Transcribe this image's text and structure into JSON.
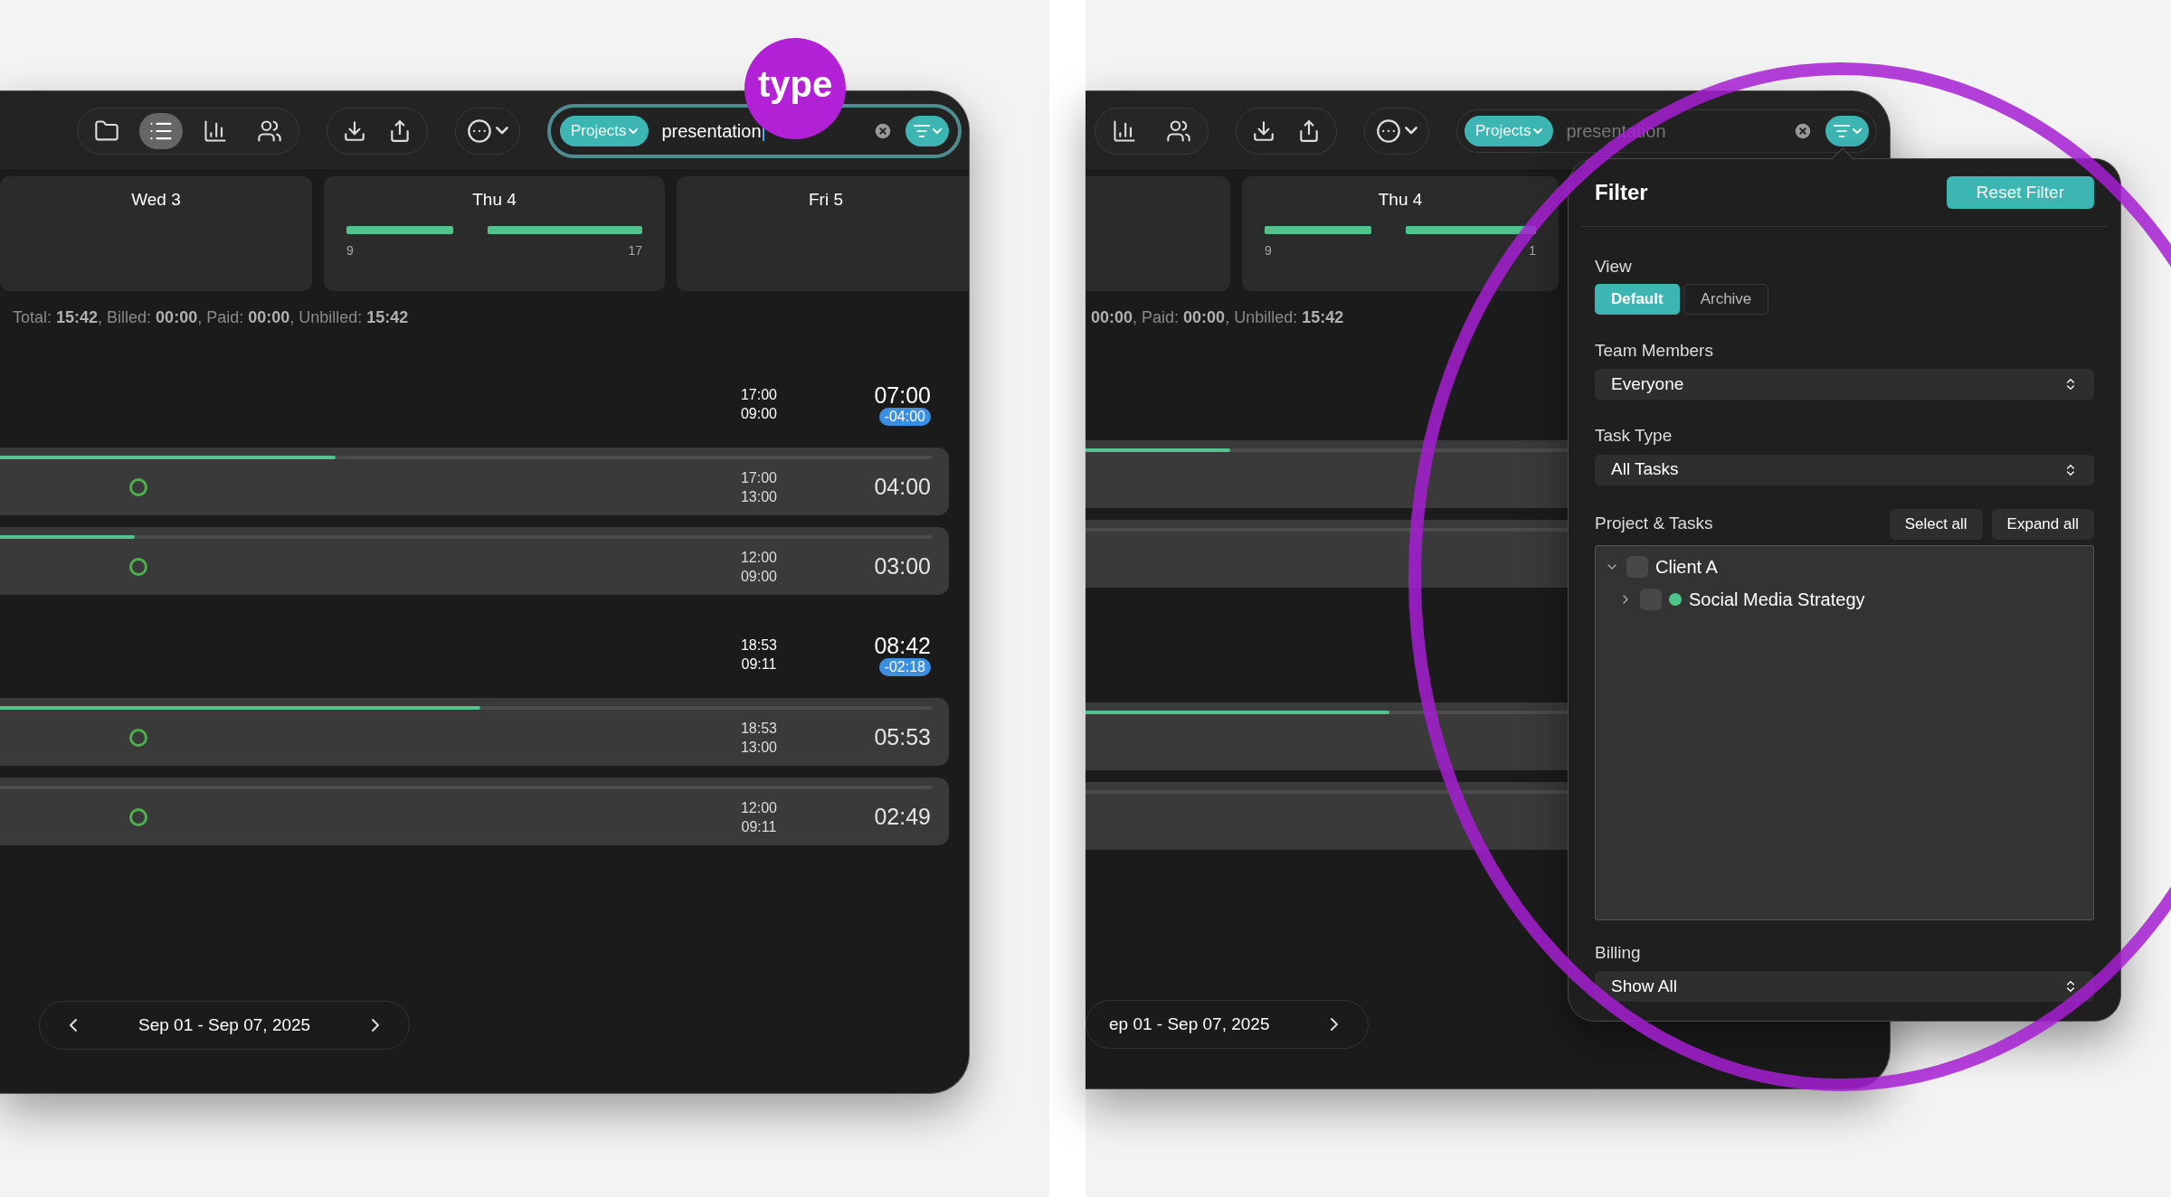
{
  "left_window": {
    "toolbar": {
      "view_buttons": [
        {
          "kind": "folder",
          "selected": false
        },
        {
          "kind": "list",
          "selected": true
        },
        {
          "kind": "chart",
          "selected": false
        },
        {
          "kind": "people",
          "selected": false
        }
      ],
      "search": {
        "scope": "Projects",
        "value": "presentation",
        "focused": true
      }
    },
    "days": [
      {
        "label": "Wed 3"
      },
      {
        "label": "Thu 4",
        "ticks": [
          "9",
          "17"
        ]
      },
      {
        "label": "Fri 5"
      }
    ],
    "summary": "Total: **15:42**, Billed: **00:00**, Paid: **00:00**, Unbilled: **15:42**",
    "groups": [
      {
        "end": "17:00",
        "start": "09:00",
        "total": "07:00",
        "difference": "-04:00",
        "entries": [
          {
            "level": 0.36,
            "end": "17:00",
            "start": "13:00",
            "duration": "04:00"
          },
          {
            "level": 0.145,
            "end": "12:00",
            "start": "09:00",
            "duration": "03:00"
          }
        ]
      },
      {
        "end": "18:53",
        "start": "09:11",
        "total": "08:42",
        "difference": "-02:18",
        "entries": [
          {
            "level": 0.515,
            "end": "18:53",
            "start": "13:00",
            "duration": "05:53"
          },
          {
            "end": "12:00",
            "start": "09:11",
            "duration": "02:49"
          }
        ]
      }
    ],
    "date_range": "Sep 01 - Sep 07, 2025"
  },
  "annotation": {
    "label": "type"
  },
  "right_window": {
    "toolbar": {
      "view_buttons": [
        {
          "kind": "chart",
          "selected": false
        },
        {
          "kind": "people",
          "selected": false
        }
      ],
      "search": {
        "scope": "Projects",
        "value": "presentation",
        "focused": false
      }
    },
    "days": [
      {
        "label": "Thu 4",
        "ticks": [
          "9",
          "1"
        ]
      }
    ],
    "summary": "**00:00**, Paid: **00:00**, Unbilled: **15:42**",
    "entries": [
      {
        "kind": "entry",
        "level": 0.3
      },
      {
        "kind": "entry"
      },
      {
        "kind": "entry",
        "level": 0.63
      },
      {
        "kind": "entry"
      }
    ],
    "date_range": "ep 01 - Sep 07, 2025",
    "filter": {
      "title": "Filter",
      "reset_button": "Reset Filter",
      "view": {
        "label": "View",
        "options": [
          {
            "label": "Default",
            "selected": true
          },
          {
            "label": "Archive",
            "selected": false
          }
        ]
      },
      "team_members": {
        "label": "Team Members",
        "value": "Everyone"
      },
      "task_type": {
        "label": "Task Type",
        "value": "All Tasks"
      },
      "projects": {
        "label": "Project & Tasks",
        "buttons": [
          "Select all",
          "Expand all"
        ],
        "tree": [
          {
            "label": "Client A",
            "expanded": true,
            "checked": false,
            "children": [
              {
                "label": "Social Media Strategy",
                "expanded": false,
                "checked": false,
                "color": "#4fc58c"
              }
            ]
          }
        ]
      },
      "billing": {
        "label": "Billing",
        "value": "Show All"
      }
    }
  }
}
